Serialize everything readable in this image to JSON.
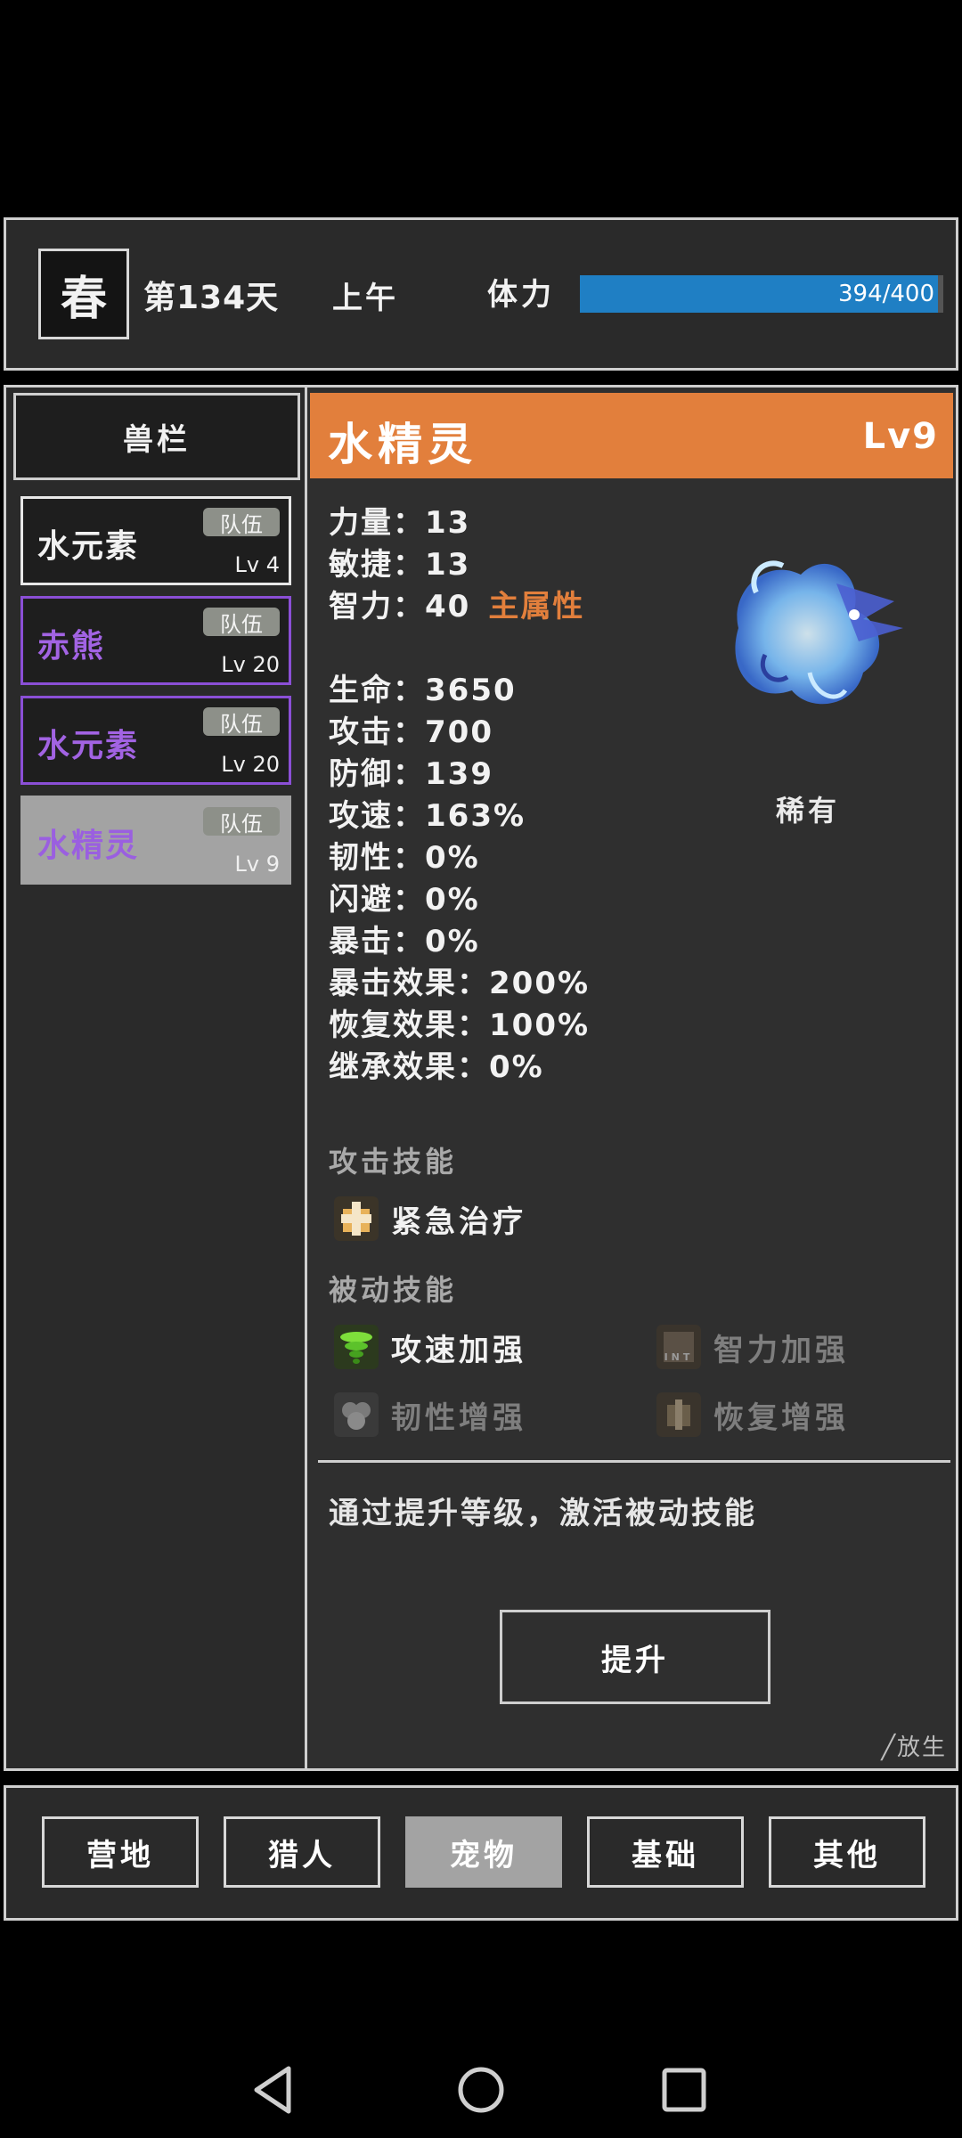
{
  "status": {
    "season": "春",
    "day": "第134天",
    "time_of_day": "上午",
    "stamina_label": "体力",
    "stamina_text": "394/400",
    "stamina_fraction": 0.985
  },
  "beast_panel": {
    "title": "兽栏",
    "items": [
      {
        "name": "水元素",
        "badge": "队伍",
        "level": "Lv 4",
        "name_color": "#f2f2f2",
        "border_color": "#e8e8e8",
        "bg": "#1e1e1e"
      },
      {
        "name": "赤熊",
        "badge": "队伍",
        "level": "Lv 20",
        "name_color": "#a263e3",
        "border_color": "#8b4fd6",
        "bg": "#1e1e1e"
      },
      {
        "name": "水元素",
        "badge": "队伍",
        "level": "Lv 20",
        "name_color": "#a263e3",
        "border_color": "#8b4fd6",
        "bg": "#1e1e1e"
      },
      {
        "name": "水精灵",
        "badge": "队伍",
        "level": "Lv 9",
        "name_color": "#9a5fe0",
        "border_color": "#a3a3a3",
        "bg": "#a3a3a3"
      }
    ]
  },
  "pet": {
    "name": "水精灵",
    "level": "Lv9",
    "rarity": "稀有",
    "main_attr_label": "主属性",
    "stats": [
      "力量：13",
      "敏捷：13",
      "智力：40",
      "生命：3650",
      "攻击：700",
      "防御：139",
      "攻速：163%",
      "韧性：0%",
      "闪避：0%",
      "暴击：0%",
      "暴击效果：200%",
      "恢复效果：100%",
      "继承效果：0%"
    ],
    "attack_skill_title": "攻击技能",
    "attack_skill": "紧急治疗",
    "passive_skill_title": "被动技能",
    "passive_skills": [
      "攻速加强",
      "智力加强",
      "韧性增强",
      "恢复增强"
    ],
    "hint": "通过提升等级，激活被动技能",
    "upgrade_label": "提升",
    "release_label": "╱放生"
  },
  "nav": {
    "tabs": [
      "营地",
      "猎人",
      "宠物",
      "基础",
      "其他"
    ],
    "active_index": 2
  },
  "colors": {
    "accent_orange": "#e27f3c",
    "stamina_blue": "#1f7fc4",
    "rare_purple": "#8b4fd6"
  },
  "icons": [
    "back-triangle-icon",
    "home-circle-icon",
    "recents-square-icon"
  ]
}
